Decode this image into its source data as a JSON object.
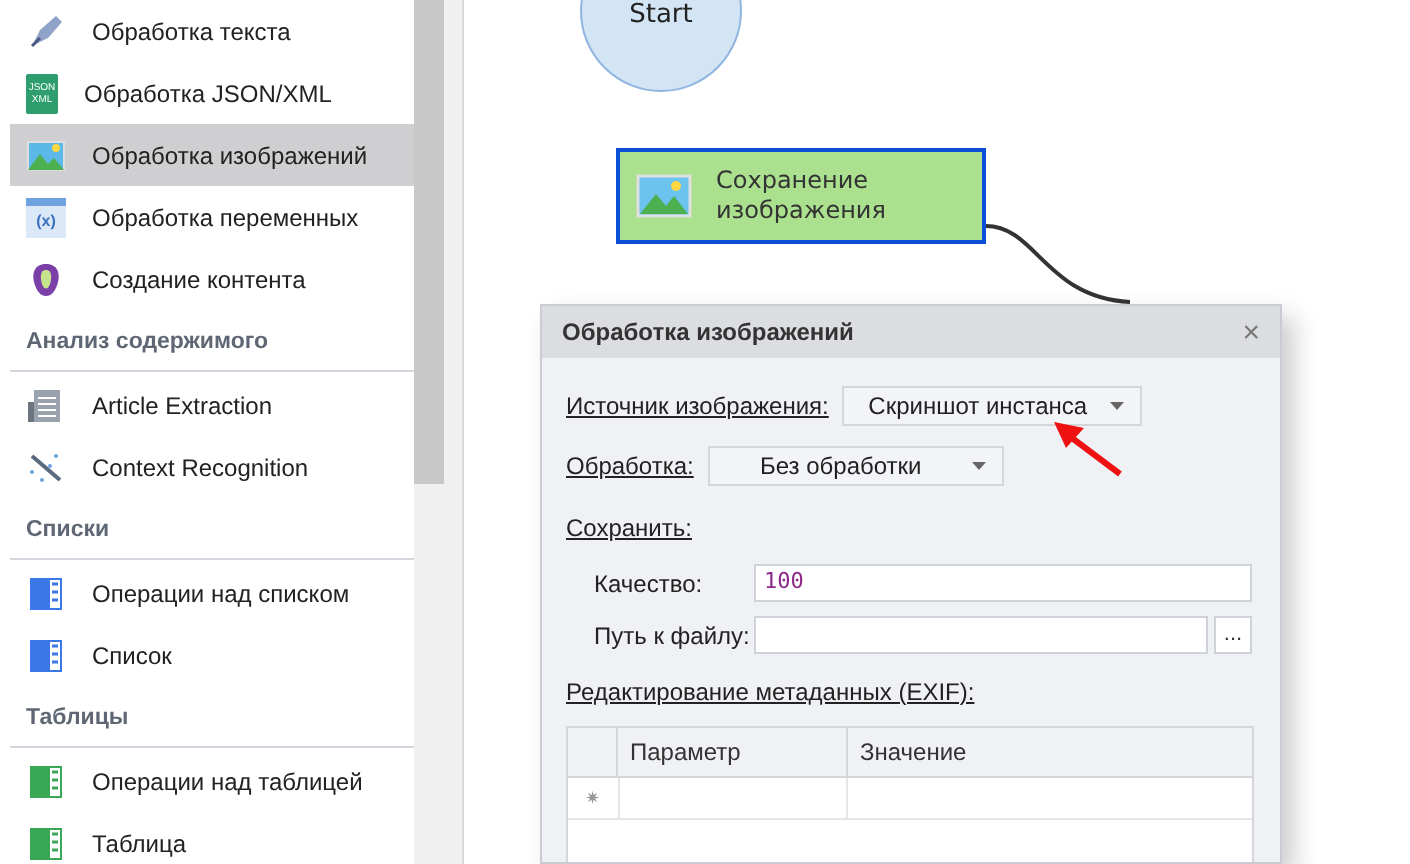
{
  "sidebar": {
    "items": [
      {
        "kind": "item",
        "label": "Обработка текста",
        "selected": false
      },
      {
        "kind": "item",
        "label": "Обработка JSON/XML",
        "icon_text": "JSON XML",
        "selected": false
      },
      {
        "kind": "item",
        "label": "Обработка изображений",
        "selected": true
      },
      {
        "kind": "item",
        "label": "Обработка переменных",
        "icon_text": "(x)",
        "selected": false
      },
      {
        "kind": "item",
        "label": "Создание контента",
        "selected": false
      },
      {
        "kind": "section",
        "label": "Анализ содержимого"
      },
      {
        "kind": "item",
        "label": "Article Extraction",
        "selected": false
      },
      {
        "kind": "item",
        "label": "Context Recognition",
        "selected": false
      },
      {
        "kind": "section",
        "label": "Списки"
      },
      {
        "kind": "item",
        "label": "Операции над списком",
        "selected": false
      },
      {
        "kind": "item",
        "label": "Список",
        "selected": false
      },
      {
        "kind": "section",
        "label": "Таблицы"
      },
      {
        "kind": "item",
        "label": "Операции над таблицей",
        "selected": false
      },
      {
        "kind": "item",
        "label": "Таблица",
        "selected": false
      }
    ]
  },
  "canvas": {
    "start_node": {
      "label": "Start"
    },
    "action_node": {
      "label": "Сохранение изображения",
      "selected": true
    }
  },
  "dialog": {
    "title": "Обработка изображений",
    "close": "×",
    "source": {
      "label": "Источник изображения:",
      "value": "Скриншот инстанса"
    },
    "processing": {
      "label": "Обработка:",
      "value": "Без обработки"
    },
    "save_label": "Сохранить:",
    "quality": {
      "label": "Качество:",
      "value": "100"
    },
    "file_path": {
      "label": "Путь к файлу:",
      "browse": "..."
    },
    "exif_label": "Редактирование метаданных (EXIF):",
    "table": {
      "columns": [
        "Параметр",
        "Значение"
      ],
      "new_row_marker": "✷"
    }
  }
}
